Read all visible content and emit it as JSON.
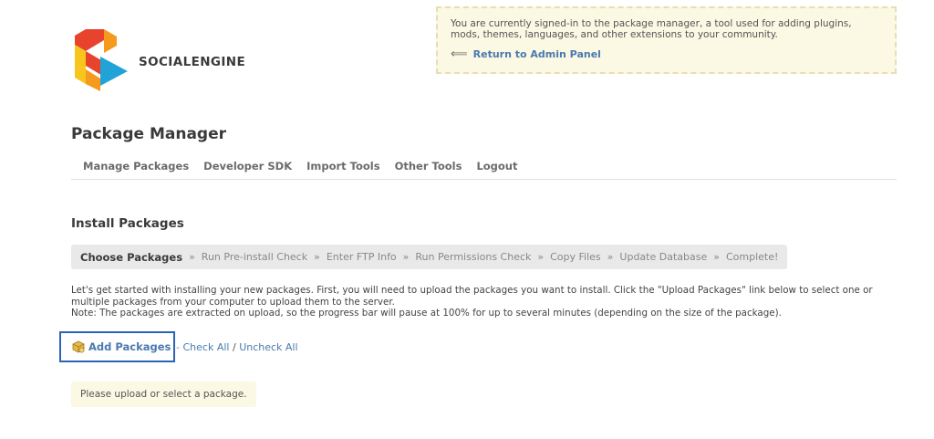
{
  "brand": {
    "name": "SOCIALENGINE",
    "colors": {
      "red": "#e8432d",
      "orange": "#f59a1c",
      "yellow": "#f7c51c",
      "blue": "#21a3d8"
    }
  },
  "notice": {
    "text": "You are currently signed-in to the package manager, a tool used for adding plugins, mods, themes, languages, and other extensions to your community.",
    "return_link": "Return to Admin Panel",
    "icon": "back-arrow-icon"
  },
  "page": {
    "title": "Package Manager"
  },
  "nav": {
    "items": [
      "Manage Packages",
      "Developer SDK",
      "Import Tools",
      "Other Tools",
      "Logout"
    ]
  },
  "section": {
    "title": "Install Packages"
  },
  "steps": {
    "items": [
      "Choose Packages",
      "Run Pre-install Check",
      "Enter FTP Info",
      "Run Permissions Check",
      "Copy Files",
      "Update Database",
      "Complete!"
    ],
    "separator": "»",
    "active_index": 0
  },
  "intro": {
    "line1": "Let's get started with installing your new packages. First, you will need to upload the packages you want to install. Click the \"Upload Packages\" link below to select one or multiple packages from your computer to upload them to the server.",
    "line2": "Note: The packages are extracted on upload, so the progress bar will pause at 100% for up to several minutes (depending on the size of the package)."
  },
  "actions": {
    "add_packages": "Add Packages",
    "dash": "-",
    "check_all": "Check All",
    "slash": "/",
    "uncheck_all": "Uncheck All"
  },
  "status": {
    "message": "Please upload or select a package."
  }
}
